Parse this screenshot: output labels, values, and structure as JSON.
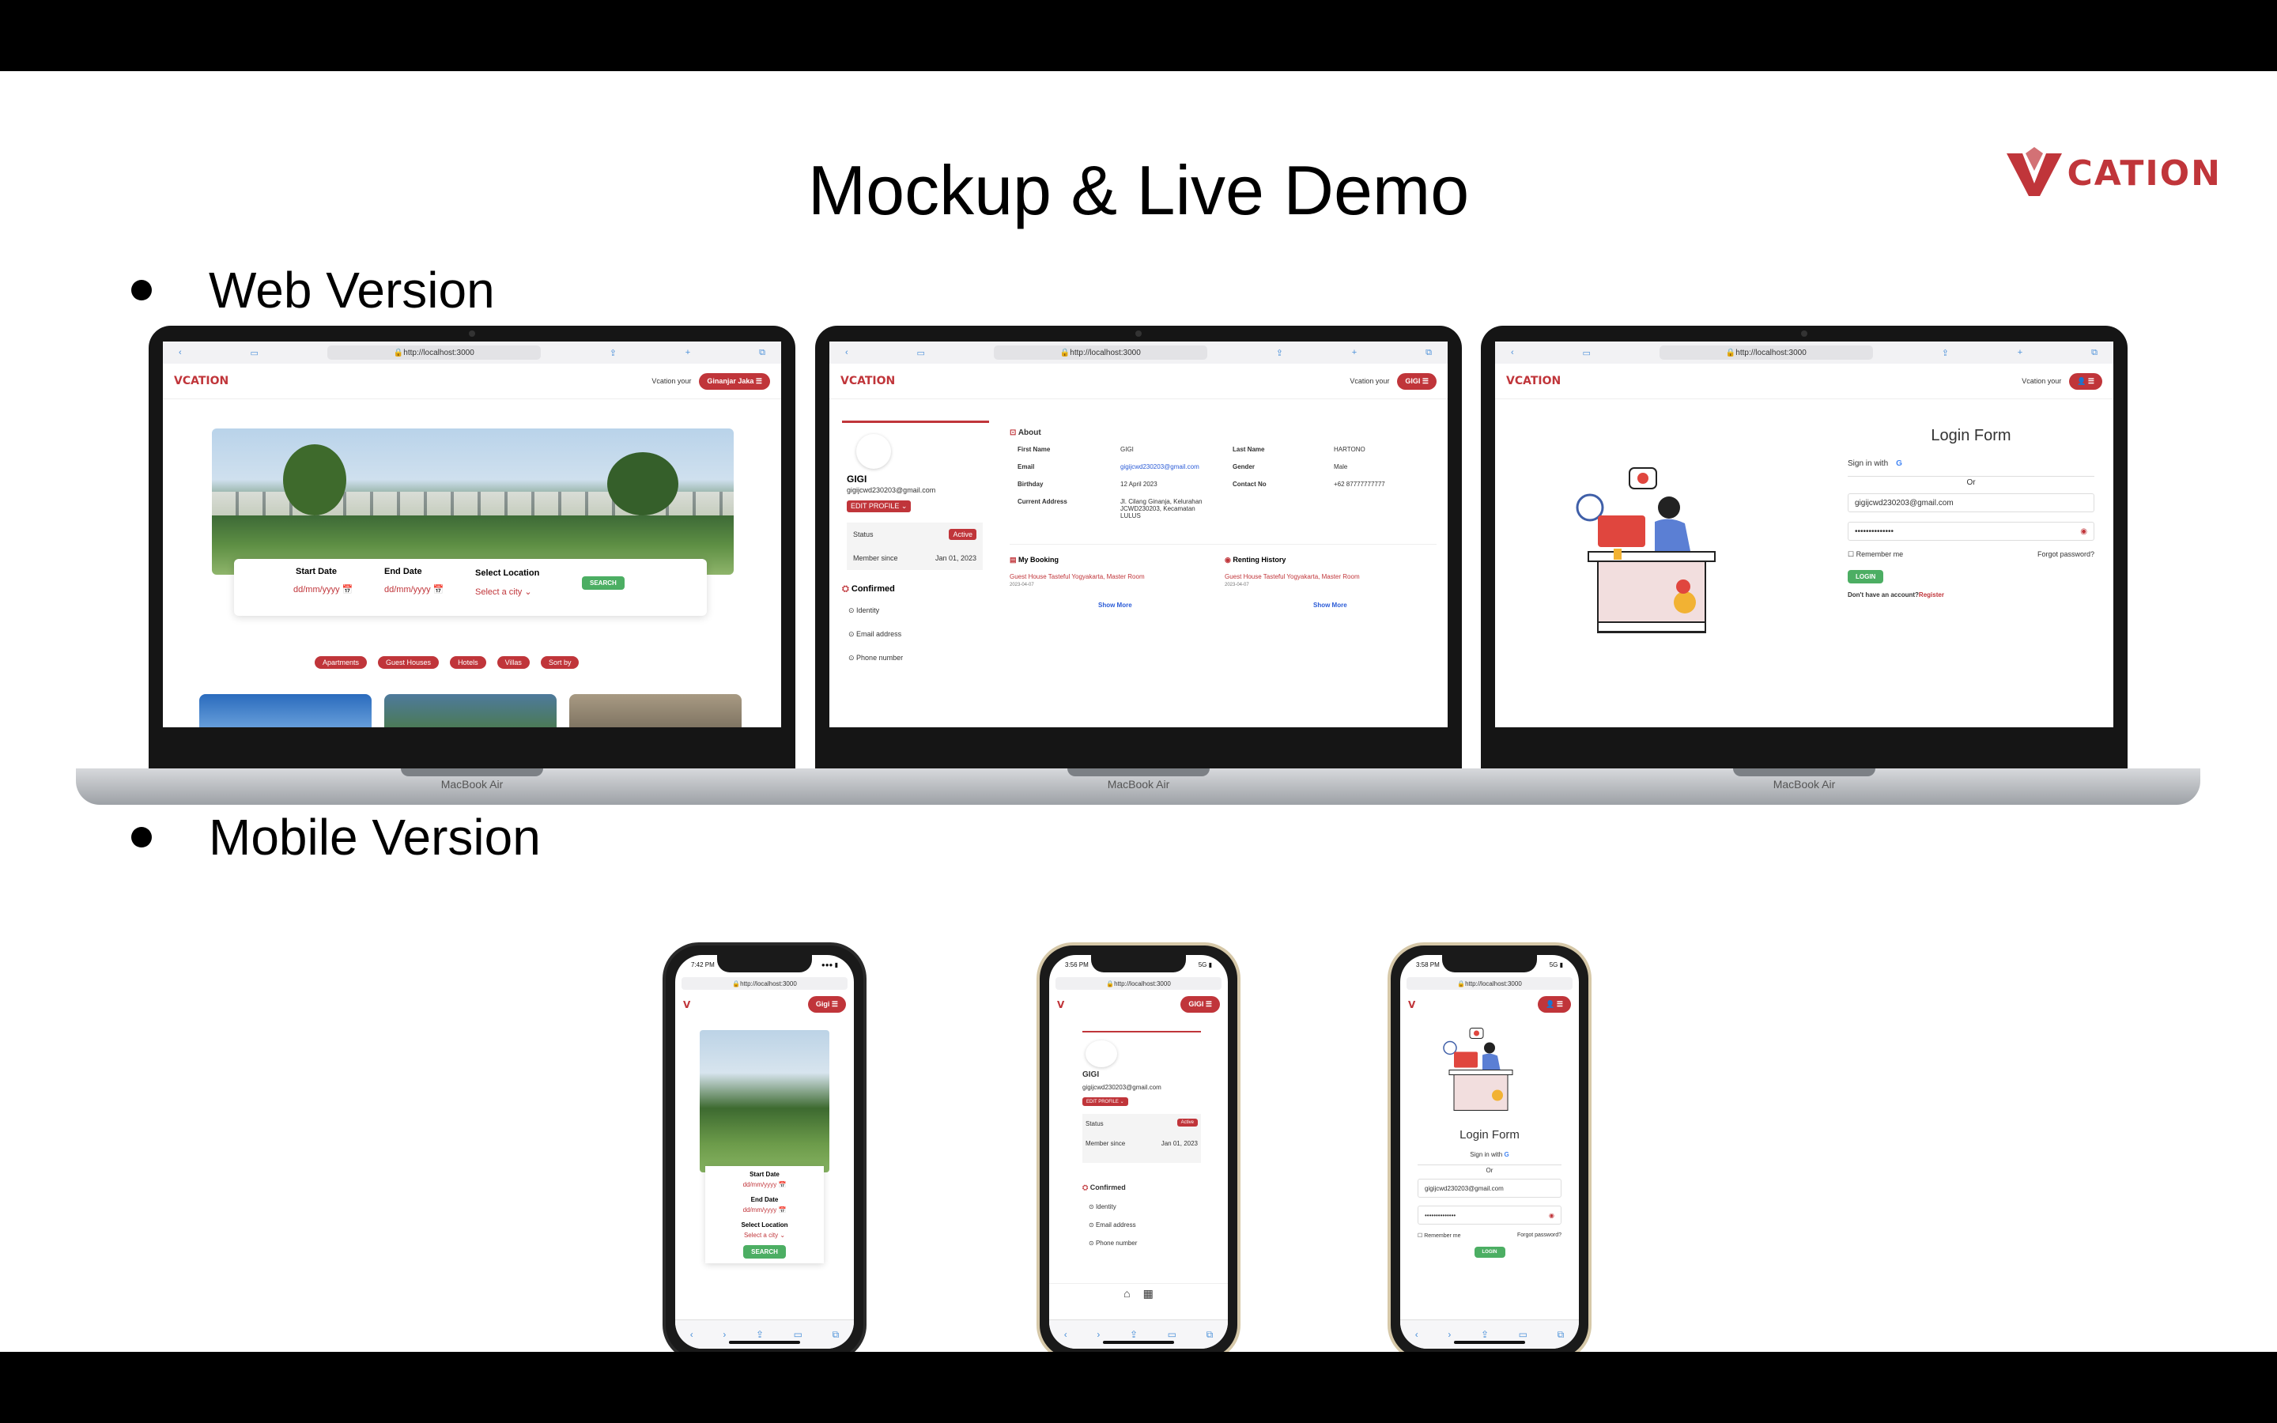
{
  "slide": {
    "title": "Mockup & Live Demo",
    "brand_name": "CATION",
    "bullet_web": "Web Version",
    "bullet_mobile": "Mobile Version",
    "laptop_model": "MacBook Air"
  },
  "browser": {
    "url": "http://localhost:3000",
    "aa": "AA"
  },
  "nav": {
    "logo": "VCATION",
    "vcation_your": "Vcation your",
    "user_home": "Ginanjar Jaka",
    "user_profile": "GIGI"
  },
  "home": {
    "start_date": "Start Date",
    "end_date": "End Date",
    "select_location": "Select Location",
    "date_placeholder": "dd/mm/yyyy",
    "city_placeholder": "Select a city",
    "search": "SEARCH",
    "chips": [
      "Apartments",
      "Guest Houses",
      "Hotels",
      "Villas",
      "Sort by"
    ]
  },
  "profile": {
    "name": "GIGI",
    "email": "gigijcwd230203@gmail.com",
    "edit": "EDIT PROFILE",
    "status_label": "Status",
    "status": "Active",
    "member_label": "Member since",
    "member_since": "Jan 01, 2023",
    "confirmed": "Confirmed",
    "identity": "Identity",
    "email_address": "Email address",
    "phone": "Phone number",
    "about": "About",
    "first_name_label": "First Name",
    "first_name": "GIGI",
    "last_name_label": "Last Name",
    "last_name": "HARTONO",
    "email_label": "Email",
    "gender_label": "Gender",
    "gender": "Male",
    "birthday_label": "Birthday",
    "birthday": "12 April 2023",
    "contact_label": "Contact No",
    "contact": "+62 87777777777",
    "address_label": "Current Address",
    "address": "Jl. Cilang Ginanja, Kelurahan JCWD230203, Kecamatan LULUS",
    "my_booking": "My Booking",
    "renting_history": "Renting History",
    "booking_item": "Guest House Tasteful Yogyakarta, Master Room",
    "booking_date": "2023-04-07",
    "show_more": "Show More"
  },
  "login": {
    "title": "Login Form",
    "sign_in_with": "Sign in with",
    "or": "Or",
    "email": "gigijcwd230203@gmail.com",
    "password": "••••••••••••••",
    "remember": "Remember me",
    "forgot": "Forgot password?",
    "login_btn": "LOGIN",
    "no_account": "Don't have an account?",
    "register": "Register"
  },
  "phones": {
    "time_1": "7:42 PM",
    "time_2": "3:56 PM",
    "time_3": "3:58 PM",
    "user": "Gigi"
  }
}
